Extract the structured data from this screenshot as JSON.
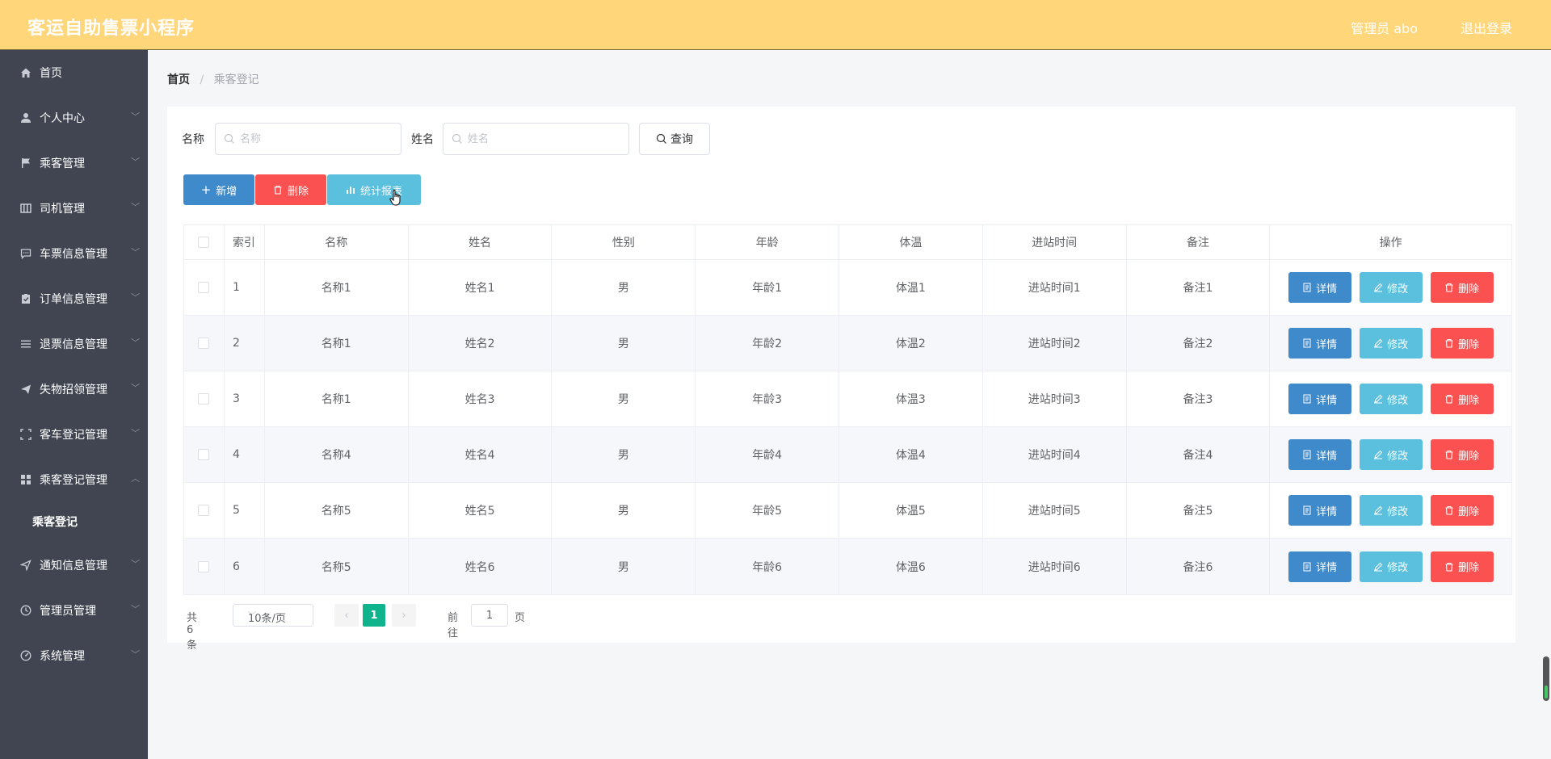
{
  "header": {
    "title": "客运自助售票小程序",
    "user": "管理员 abo",
    "logout": "退出登录"
  },
  "sidebar": {
    "items": [
      {
        "label": "首页",
        "icon": "home-icon"
      },
      {
        "label": "个人中心",
        "icon": "user-icon"
      },
      {
        "label": "乘客管理",
        "icon": "flag-icon"
      },
      {
        "label": "司机管理",
        "icon": "book-icon"
      },
      {
        "label": "车票信息管理",
        "icon": "chat-icon"
      },
      {
        "label": "订单信息管理",
        "icon": "clipboard-check-icon"
      },
      {
        "label": "退票信息管理",
        "icon": "list-icon"
      },
      {
        "label": "失物招领管理",
        "icon": "send-icon"
      },
      {
        "label": "客车登记管理",
        "icon": "fullscreen-icon"
      },
      {
        "label": "乘客登记管理",
        "icon": "grid-icon"
      },
      {
        "label": "乘客登记"
      },
      {
        "label": "通知信息管理",
        "icon": "navigation-icon"
      },
      {
        "label": "管理员管理",
        "icon": "clock-icon"
      },
      {
        "label": "系统管理",
        "icon": "speedometer-icon"
      }
    ]
  },
  "breadcrumb": {
    "home": "首页",
    "separator": "/",
    "current": "乘客登记"
  },
  "search": {
    "name_label": "名称",
    "name_placeholder": "名称",
    "surname_label": "姓名",
    "surname_placeholder": "姓名",
    "query_label": "查询"
  },
  "toolbar": {
    "add_label": "新增",
    "delete_label": "删除",
    "report_label": "统计报表"
  },
  "table": {
    "headers": [
      "索引",
      "名称",
      "姓名",
      "性别",
      "年龄",
      "体温",
      "进站时间",
      "备注",
      "操作"
    ],
    "rows": [
      {
        "idx": "1",
        "name": "名称1",
        "surname": "姓名1",
        "gender": "男",
        "age": "年龄1",
        "temp": "体温1",
        "time": "进站时间1",
        "note": "备注1"
      },
      {
        "idx": "2",
        "name": "名称1",
        "surname": "姓名2",
        "gender": "男",
        "age": "年龄2",
        "temp": "体温2",
        "time": "进站时间2",
        "note": "备注2"
      },
      {
        "idx": "3",
        "name": "名称1",
        "surname": "姓名3",
        "gender": "男",
        "age": "年龄3",
        "temp": "体温3",
        "time": "进站时间3",
        "note": "备注3"
      },
      {
        "idx": "4",
        "name": "名称4",
        "surname": "姓名4",
        "gender": "男",
        "age": "年龄4",
        "temp": "体温4",
        "time": "进站时间4",
        "note": "备注4"
      },
      {
        "idx": "5",
        "name": "名称5",
        "surname": "姓名5",
        "gender": "男",
        "age": "年龄5",
        "temp": "体温5",
        "time": "进站时间5",
        "note": "备注5"
      },
      {
        "idx": "6",
        "name": "名称5",
        "surname": "姓名6",
        "gender": "男",
        "age": "年龄6",
        "temp": "体温6",
        "time": "进站时间6",
        "note": "备注6"
      }
    ],
    "ops": {
      "detail": "详情",
      "edit": "修改",
      "delete": "删除"
    }
  },
  "pagination": {
    "total": "共 6 条",
    "page_size": "10条/页",
    "current_page": "1",
    "goto_label": "前往",
    "goto_value": "1",
    "page_unit": "页"
  },
  "colors": {
    "header_bg": "#ffd67a",
    "sidebar_bg": "#404551",
    "primary": "#3f8acb",
    "danger": "#fb5151",
    "info": "#5bc0de",
    "pager_active": "#10b48c"
  }
}
